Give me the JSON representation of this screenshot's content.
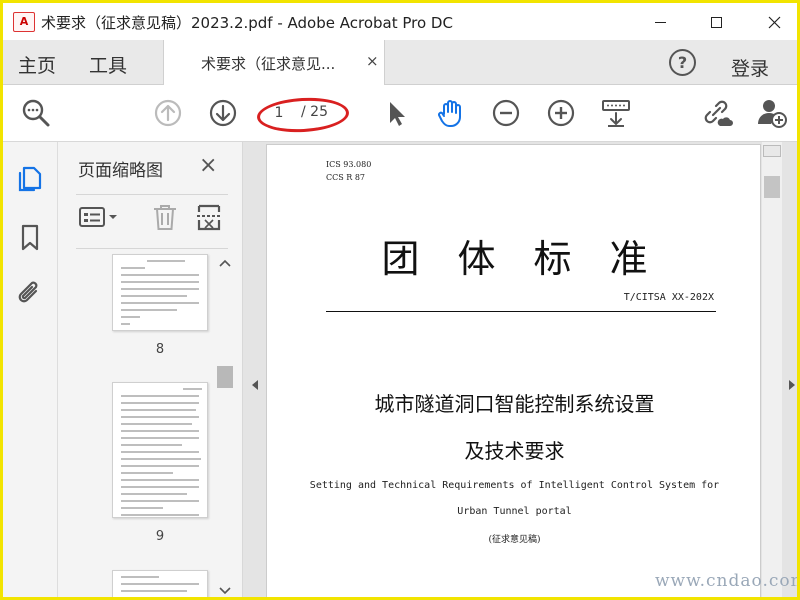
{
  "titlebar": {
    "title": "术要求（征求意见稿）2023.2.pdf - Adobe Acrobat Pro DC",
    "app_icon_text": "A"
  },
  "tabs": {
    "home": "主页",
    "tools": "工具",
    "document": "术要求（征求意见...",
    "document_close": "×",
    "help": "?",
    "login": "登录"
  },
  "toolbar": {
    "page_current": "1",
    "page_total": "/ 25"
  },
  "thumbnails": {
    "title": "页面缩略图",
    "close": "×",
    "pages": [
      {
        "label": "8"
      },
      {
        "label": "9"
      }
    ]
  },
  "document": {
    "ics": "ICS 93.080",
    "ccs": "CCS R 87",
    "heading": "团体标准",
    "standard_number": "T/CITSA XX-202X",
    "title_cn_line1": "城市隧道洞口智能控制系统设置",
    "title_cn_line2": "及技术要求",
    "title_en_line1": "Setting and Technical Requirements of Intelligent Control System for",
    "title_en_line2": "Urban Tunnel portal",
    "draft_note": "(征求意见稿)"
  },
  "watermark": "www.cndao.com",
  "colors": {
    "frame_border": "#f2e400",
    "annotation_red": "#d92020",
    "active_blue": "#1473e6"
  }
}
